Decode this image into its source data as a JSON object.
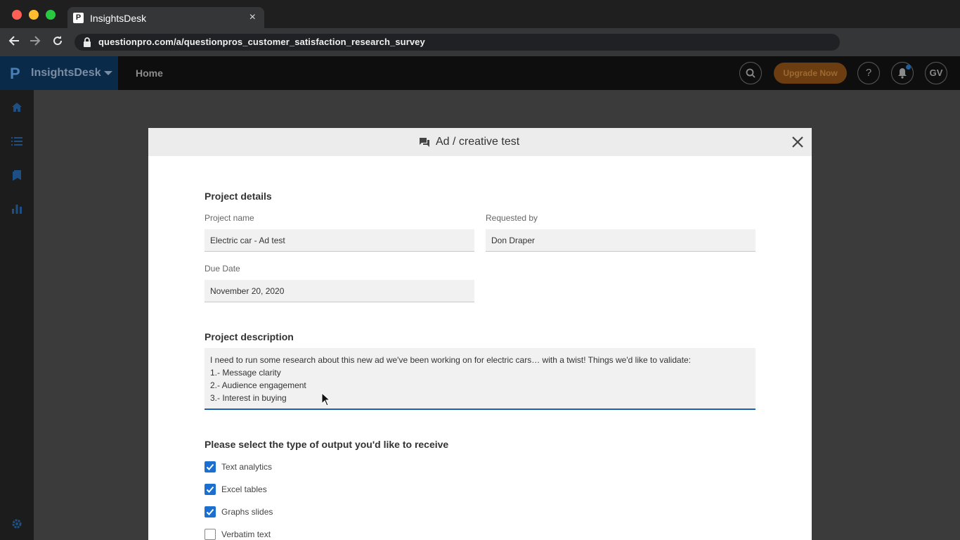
{
  "browser": {
    "tab_title": "InsightsDesk",
    "tab_favicon": "P",
    "tab_close": "×",
    "url": "questionpro.com/a/questionpros_customer_satisfaction_research_survey"
  },
  "app": {
    "logo": "P",
    "brand": "InsightsDesk",
    "nav_home": "Home",
    "upgrade_label": "Upgrade Now",
    "help": "?",
    "avatar": "GV"
  },
  "modal": {
    "title": "Ad / creative test",
    "project_details_title": "Project details",
    "project_name_label": "Project name",
    "project_name_value": "Electric car - Ad test",
    "requested_by_label": "Requested by",
    "requested_by_value": "Don Draper",
    "due_date_label": "Due Date",
    "due_date_value": "November 20, 2020",
    "description_title": "Project description",
    "description_lines": [
      "I need to run some research about this new ad we've been working on for electric cars… with a twist! Things we'd like to validate:",
      "1.- Message clarity",
      "2.- Audience engagement",
      "3.- Interest in buying"
    ],
    "output_title": "Please select the type of output you'd like to receive",
    "outputs": [
      {
        "label": "Text analytics",
        "checked": true
      },
      {
        "label": "Excel tables",
        "checked": true
      },
      {
        "label": "Graphs slides",
        "checked": true
      },
      {
        "label": "Verbatim text",
        "checked": false
      }
    ]
  },
  "colors": {
    "accent": "#1a6fd0",
    "upgrade": "#6b3d10"
  }
}
